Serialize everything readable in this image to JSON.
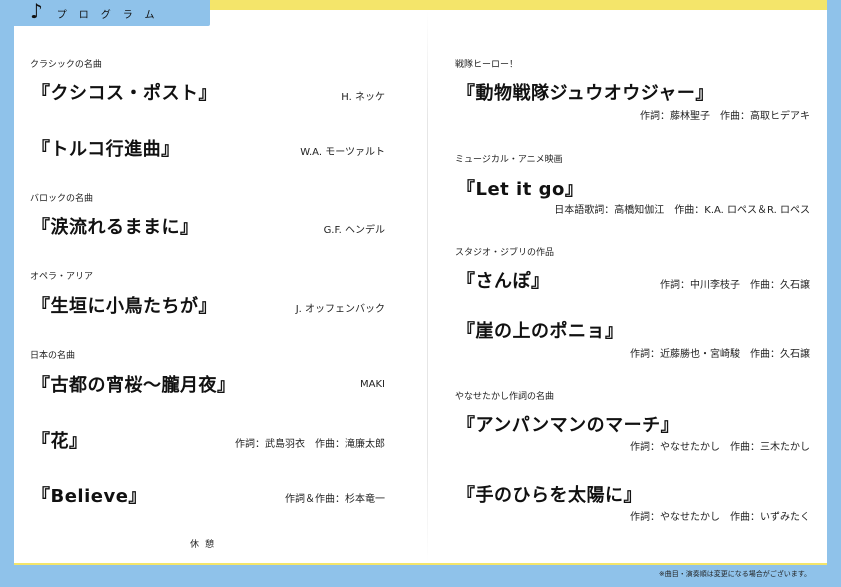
{
  "header": {
    "note_glyph": "♪",
    "title": "プログラム"
  },
  "left": [
    {
      "category": "クラシックの名曲",
      "songs": [
        {
          "title": "『クシコス・ポスト』",
          "credit": "H. ネッケ"
        },
        {
          "title": "『トルコ行進曲』",
          "credit": "W.A. モーツァルト"
        }
      ]
    },
    {
      "category": "バロックの名曲",
      "songs": [
        {
          "title": "『涙流れるままに』",
          "credit": "G.F. ヘンデル"
        }
      ]
    },
    {
      "category": "オペラ・アリア",
      "songs": [
        {
          "title": "『生垣に小鳥たちが』",
          "credit": "J. オッフェンバック"
        }
      ]
    },
    {
      "category": "日本の名曲",
      "songs": [
        {
          "title": "『古都の宵桜〜朧月夜』",
          "credit": "MAKI"
        },
        {
          "title": "『花』",
          "credit": "作詞：武島羽衣　作曲：滝廉太郎"
        },
        {
          "title": "『Believe』",
          "credit": "作詞＆作曲：杉本竜一"
        }
      ]
    }
  ],
  "intermission": "休憩",
  "right": [
    {
      "category": "戦隊ヒーロー！",
      "songs": [
        {
          "title": "『動物戦隊ジュウオウジャー』",
          "credit": "作詞：藤林聖子　作曲：高取ヒデアキ"
        }
      ]
    },
    {
      "category": "ミュージカル・アニメ映画",
      "songs": [
        {
          "title": "『Let it go』",
          "credit": "日本語歌詞：高橋知伽江　作曲：K.A. ロペス＆R. ロペス"
        }
      ]
    },
    {
      "category": "スタジオ・ジブリの作品",
      "songs": [
        {
          "title": "『さんぽ』",
          "credit": "作詞：中川李枝子　作曲：久石譲"
        },
        {
          "title": "『崖の上のポニョ』",
          "credit": "作詞：近藤勝也・宮崎駿　作曲：久石譲"
        }
      ]
    },
    {
      "category": "やなせたかし作詞の名曲",
      "songs": [
        {
          "title": "『アンパンマンのマーチ』",
          "credit": "作詞：やなせたかし　作曲：三木たかし"
        },
        {
          "title": "『手のひらを太陽に』",
          "credit": "作詞：やなせたかし　作曲：いずみたく"
        }
      ]
    }
  ],
  "footnote": "※曲目・演奏順は変更になる場合がございます。"
}
